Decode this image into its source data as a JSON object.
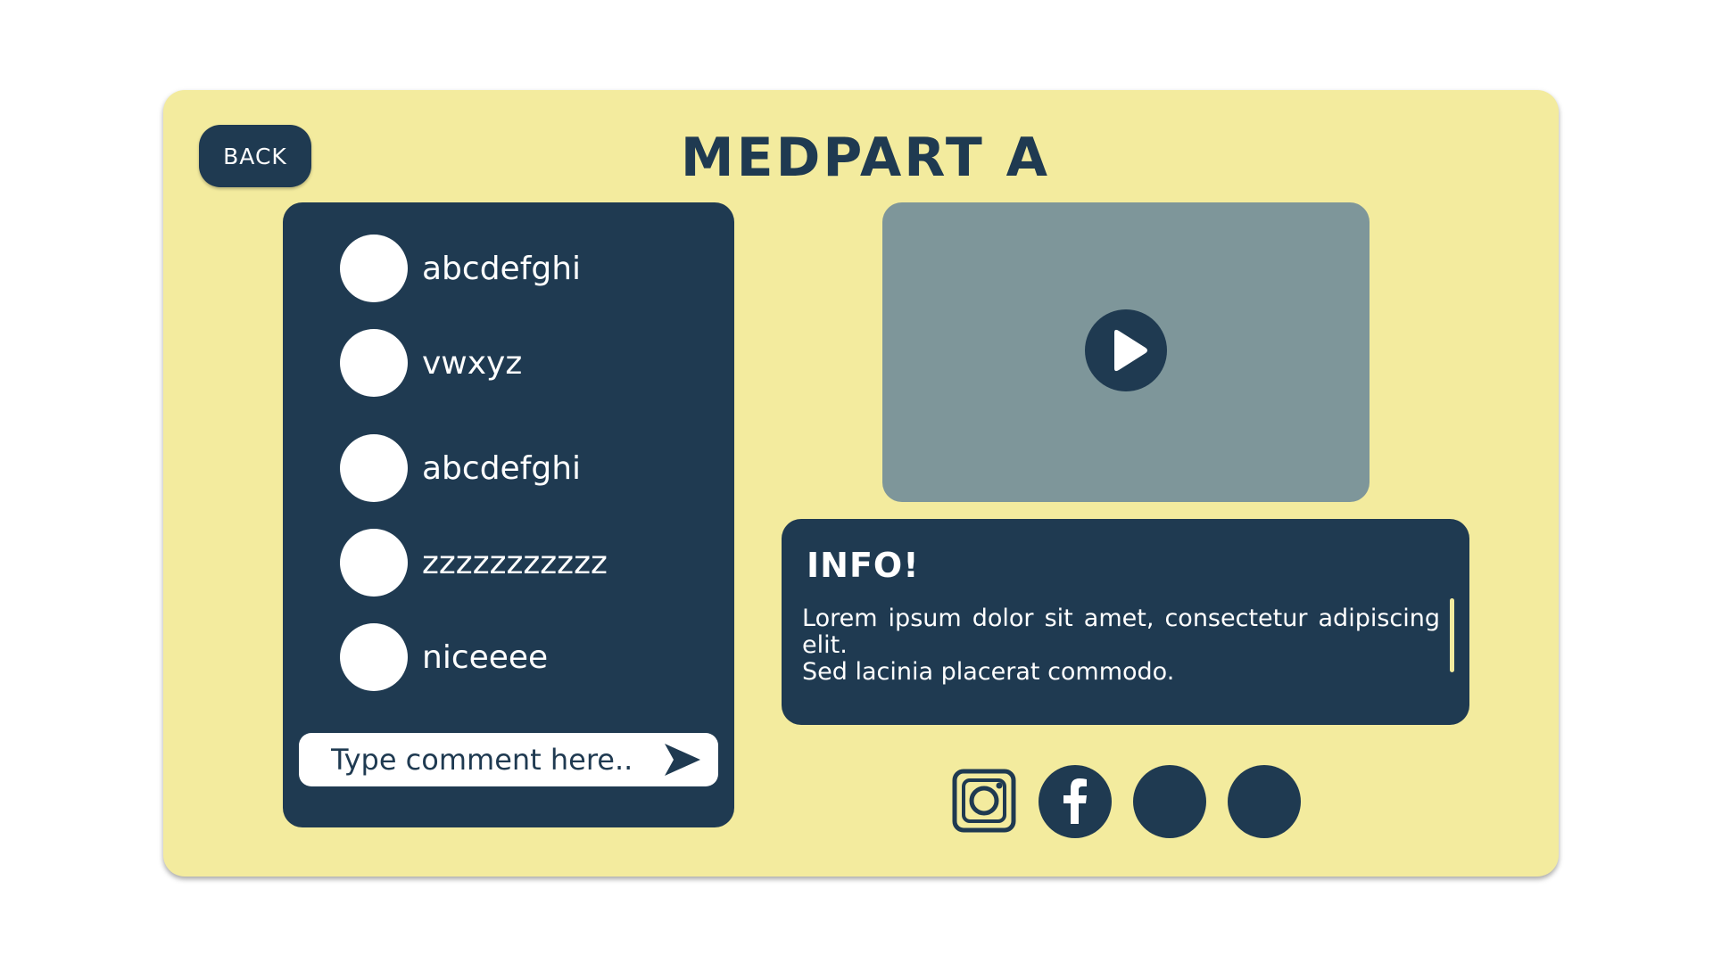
{
  "header": {
    "back_label": "BACK",
    "title": "MEDPART A"
  },
  "comments": {
    "items": [
      {
        "text": "abcdefghi"
      },
      {
        "text": "vwxyz"
      },
      {
        "text": "abcdefghi"
      },
      {
        "text": "zzzzzzzzzzz"
      },
      {
        "text": "niceeee"
      }
    ],
    "input_placeholder": "Type comment here..."
  },
  "video": {
    "play_icon": "play-icon"
  },
  "info": {
    "title": "INFO!",
    "line1": "Lorem ipsum dolor sit amet, consectetur adipiscing elit.",
    "line2": "Sed lacinia placerat commodo."
  },
  "social": [
    {
      "icon": "instagram-icon"
    },
    {
      "icon": "facebook-icon"
    },
    {
      "icon": "social-icon"
    },
    {
      "icon": "social-icon"
    }
  ],
  "colors": {
    "background": "#ffffff",
    "card": "#f3eb9e",
    "primary": "#1f3a51",
    "video": "#7e969a"
  }
}
